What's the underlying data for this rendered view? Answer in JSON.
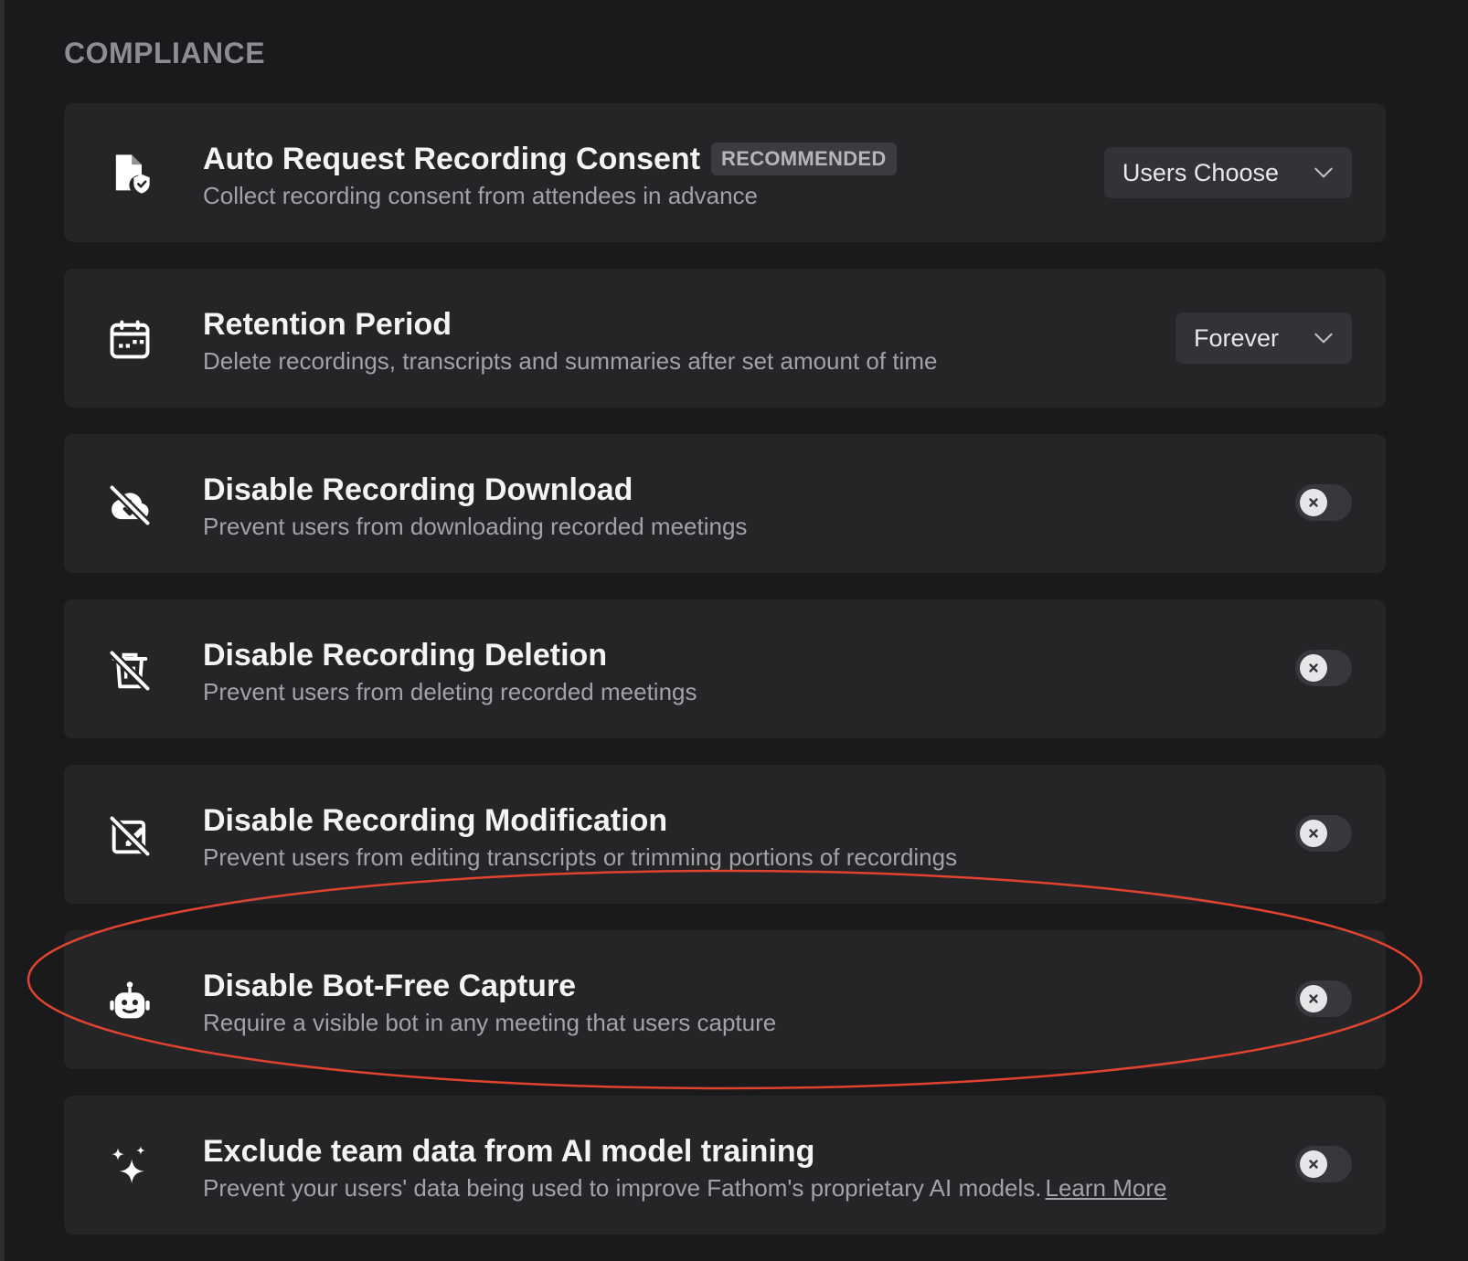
{
  "section": {
    "title": "COMPLIANCE"
  },
  "colors": {
    "background": "#1a1a1c",
    "card": "#252528",
    "highlight": "#e0442e"
  },
  "rows": [
    {
      "icon": "document-shield-icon",
      "title": "Auto Request Recording Consent",
      "badge": "RECOMMENDED",
      "description": "Collect recording consent from attendees in advance",
      "control": "dropdown",
      "value": "Users Choose"
    },
    {
      "icon": "calendar-icon",
      "title": "Retention Period",
      "description": "Delete recordings, transcripts and summaries after set amount of time",
      "control": "dropdown",
      "value": "Forever"
    },
    {
      "icon": "cloud-download-off-icon",
      "title": "Disable Recording Download",
      "description": "Prevent users from downloading recorded meetings",
      "control": "toggle",
      "state": "off"
    },
    {
      "icon": "trash-off-icon",
      "title": "Disable Recording Deletion",
      "description": "Prevent users from deleting recorded meetings",
      "control": "toggle",
      "state": "off"
    },
    {
      "icon": "edit-off-icon",
      "title": "Disable Recording Modification",
      "description": "Prevent users from editing transcripts or trimming portions of recordings",
      "control": "toggle",
      "state": "off"
    },
    {
      "icon": "robot-icon",
      "title": "Disable Bot-Free Capture",
      "description": "Require a visible bot in any meeting that users capture",
      "control": "toggle",
      "state": "off"
    },
    {
      "icon": "sparkles-icon",
      "title": "Exclude team data from AI model training",
      "description": "Prevent your users' data being used to improve Fathom's proprietary AI models.",
      "link": "Learn More",
      "control": "toggle",
      "state": "off"
    }
  ]
}
